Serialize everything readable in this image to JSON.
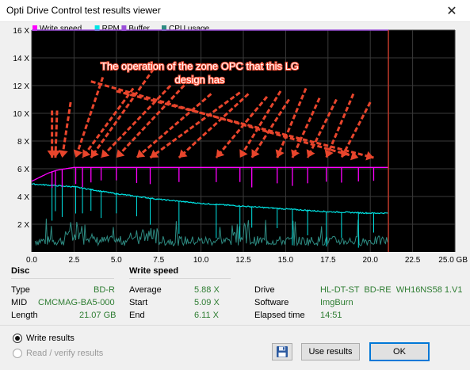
{
  "window": {
    "title": "Opti Drive Control test results viewer",
    "close_glyph": "✕"
  },
  "legend": [
    {
      "label": "Write speed",
      "color": "#ff00ff"
    },
    {
      "label": "RPM",
      "color": "#00e5e5"
    },
    {
      "label": "Buffer",
      "color": "#9a4fd8"
    },
    {
      "label": "CPU usage",
      "color": "#2e8b82"
    }
  ],
  "annotation": {
    "line1": "The operation of the zone OPC that this LG",
    "line2": "design has",
    "color": "#f0543c"
  },
  "chart_data": {
    "type": "line",
    "x_ticks": [
      "0.0",
      "2.5",
      "5.0",
      "7.5",
      "10.0",
      "12.5",
      "15.0",
      "17.5",
      "20.0",
      "22.5",
      "25.0 GB"
    ],
    "y_ticks": [
      "2 X",
      "4 X",
      "6 X",
      "8 X",
      "10 X",
      "12 X",
      "14 X",
      "16 X"
    ],
    "xlim": [
      0,
      25
    ],
    "ylim": [
      0,
      16
    ],
    "end_marker_x": 21.07,
    "grid": true,
    "legend_position": "top-left",
    "series": [
      {
        "name": "Write speed",
        "x": [
          0,
          0.5,
          1.0,
          1.5,
          2.0,
          2.5,
          5.0,
          10.0,
          15.0,
          20.0,
          21.07
        ],
        "values": [
          5.1,
          5.4,
          5.7,
          5.9,
          6.0,
          6.1,
          6.1,
          6.1,
          6.1,
          6.1,
          6.1
        ]
      },
      {
        "name": "RPM",
        "x": [
          0,
          2.5,
          5.0,
          7.5,
          10.0,
          12.5,
          15.0,
          17.5,
          20.0,
          21.07
        ],
        "values": [
          4.9,
          4.7,
          4.2,
          3.8,
          3.5,
          3.3,
          3.1,
          2.9,
          2.8,
          2.8
        ]
      }
    ],
    "dip_positions": [
      1.2,
      1.4,
      1.8,
      2.6,
      3.0,
      3.5,
      4.1,
      5.0,
      6.2,
      7.0,
      8.7,
      10.9,
      12.3,
      13.0,
      14.5,
      15.4,
      16.3,
      17.4,
      18.3,
      19.3,
      20.2
    ]
  },
  "disc": {
    "section": "Disc",
    "type_label": "Type",
    "type_value": "BD-R",
    "mid_label": "MID",
    "mid_value": "CMCMAG-BA5-000",
    "length_label": "Length",
    "length_value": "21.07 GB"
  },
  "write_speed": {
    "section": "Write speed",
    "average_label": "Average",
    "average_value": "5.88 X",
    "start_label": "Start",
    "start_value": "5.09 X",
    "end_label": "End",
    "end_value": "6.11 X"
  },
  "drive_info": {
    "drive_label": "Drive",
    "drive_value": "HL-DT-ST  BD-RE  WH16NS58 1.V1",
    "software_label": "Software",
    "software_value": "ImgBurn",
    "elapsed_label": "Elapsed time",
    "elapsed_value": "14:51"
  },
  "footer": {
    "radio_write": "Write results",
    "radio_read": "Read / verify results",
    "use_results": "Use results",
    "ok": "OK",
    "save_icon": "floppy-disk"
  }
}
